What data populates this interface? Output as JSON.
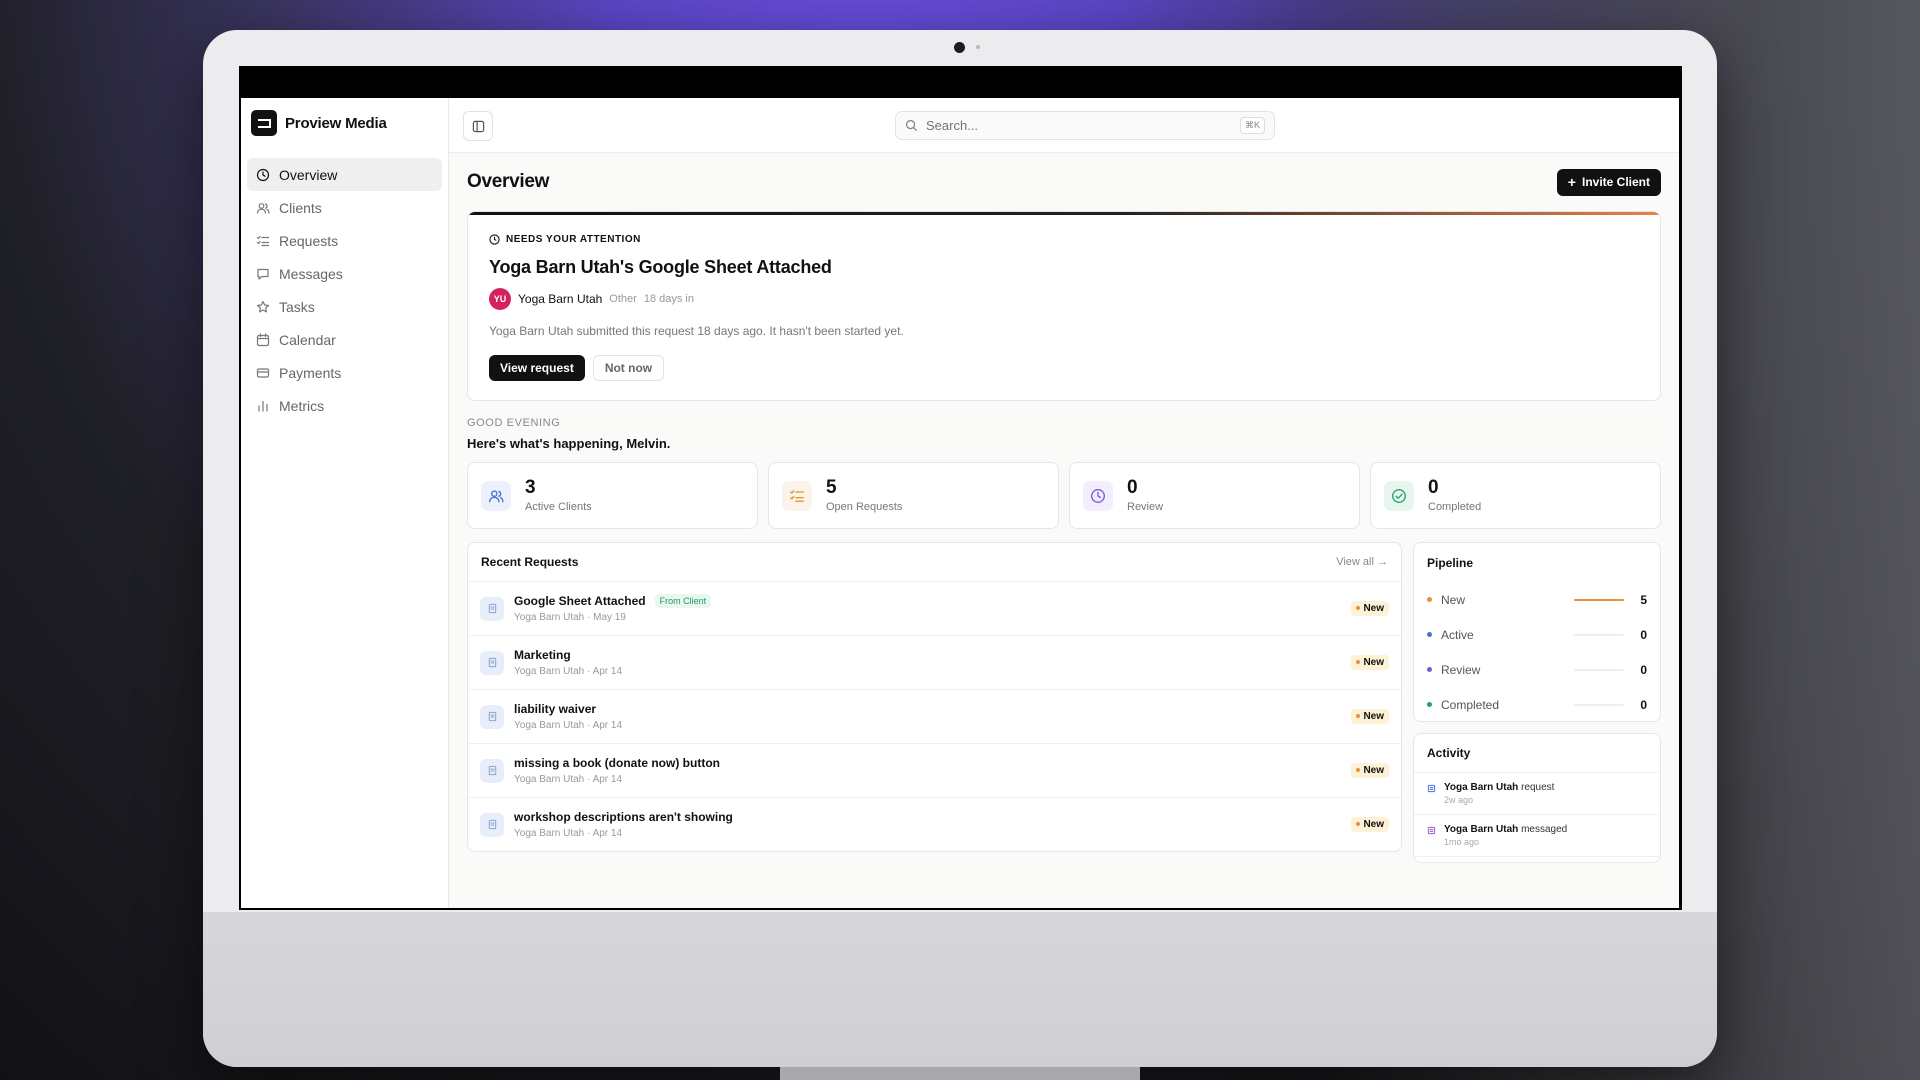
{
  "brand": {
    "name": "Proview Media"
  },
  "sidebar": {
    "items": [
      {
        "label": "Overview",
        "icon": "clock-icon"
      },
      {
        "label": "Clients",
        "icon": "users-icon"
      },
      {
        "label": "Requests",
        "icon": "list-icon"
      },
      {
        "label": "Messages",
        "icon": "message-icon"
      },
      {
        "label": "Tasks",
        "icon": "star-icon"
      },
      {
        "label": "Calendar",
        "icon": "calendar-icon"
      },
      {
        "label": "Payments",
        "icon": "card-icon"
      },
      {
        "label": "Metrics",
        "icon": "bar-chart-icon"
      }
    ]
  },
  "search": {
    "placeholder": "Search...",
    "shortcut": "⌘K"
  },
  "page": {
    "title": "Overview",
    "invite_label": "Invite Client"
  },
  "attention": {
    "label": "NEEDS YOUR ATTENTION",
    "title": "Yoga Barn Utah's Google Sheet Attached",
    "avatar_initials": "YU",
    "client": "Yoga Barn Utah",
    "type": "Other",
    "age": "18 days in",
    "description": "Yoga Barn Utah submitted this request 18 days ago. It hasn't been started yet.",
    "primary_action": "View request",
    "secondary_action": "Not now"
  },
  "greeting": {
    "kicker": "GOOD EVENING",
    "message": "Here's what's happening, Melvin."
  },
  "stats": [
    {
      "value": "3",
      "label": "Active Clients",
      "icon": "users-icon",
      "color": "#4a72d8"
    },
    {
      "value": "5",
      "label": "Open Requests",
      "icon": "list-icon",
      "color": "#e0962f"
    },
    {
      "value": "0",
      "label": "Review",
      "icon": "clock-icon",
      "color": "#7b5ad6"
    },
    {
      "value": "0",
      "label": "Completed",
      "icon": "check-circle-icon",
      "color": "#22a36b"
    }
  ],
  "recent": {
    "title": "Recent Requests",
    "view_all": "View all",
    "rows": [
      {
        "title": "Google Sheet Attached",
        "tag": "From Client",
        "sub": "Yoga Barn Utah · May 19",
        "status": "New"
      },
      {
        "title": "Marketing",
        "tag": "",
        "sub": "Yoga Barn Utah · Apr 14",
        "status": "New"
      },
      {
        "title": "liability waiver",
        "tag": "",
        "sub": "Yoga Barn Utah · Apr 14",
        "status": "New"
      },
      {
        "title": "missing a book (donate now) button",
        "tag": "",
        "sub": "Yoga Barn Utah · Apr 14",
        "status": "New"
      },
      {
        "title": "workshop descriptions aren't showing",
        "tag": "",
        "sub": "Yoga Barn Utah · Apr 14",
        "status": "New"
      }
    ]
  },
  "pipeline": {
    "title": "Pipeline",
    "rows": [
      {
        "name": "New",
        "value": "5",
        "color": "#e8903a",
        "fill": 1.0
      },
      {
        "name": "Active",
        "value": "0",
        "color": "#4a72d8",
        "fill": 0
      },
      {
        "name": "Review",
        "value": "0",
        "color": "#7b5ad6",
        "fill": 0
      },
      {
        "name": "Completed",
        "value": "0",
        "color": "#22a36b",
        "fill": 0
      }
    ]
  },
  "activity": {
    "title": "Activity",
    "rows": [
      {
        "who": "Yoga Barn Utah",
        "action": "request",
        "time": "2w ago",
        "color": "#4a72d8"
      },
      {
        "who": "Yoga Barn Utah",
        "action": "messaged",
        "time": "1mo ago",
        "color": "#9a5ad6"
      }
    ]
  }
}
